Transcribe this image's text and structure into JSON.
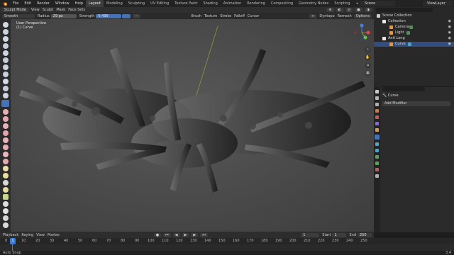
{
  "menubar": {
    "menus": [
      "File",
      "Edit",
      "Render",
      "Window",
      "Help"
    ],
    "workspaces": [
      "Layout",
      "Modeling",
      "Sculpting",
      "UV Editing",
      "Texture Paint",
      "Shading",
      "Animation",
      "Rendering",
      "Compositing",
      "Geometry Nodes",
      "Scripting"
    ],
    "active_workspace": "Layout",
    "scene": "Scene",
    "view_layer": "ViewLayer"
  },
  "header": {
    "mode": "Sculpt Mode",
    "menus": [
      "View",
      "Sculpt",
      "Mask",
      "Face Sets"
    ],
    "brush_name": "Smooth",
    "radius_label": "Radius",
    "radius_value": "29 px",
    "strength_label": "Strength",
    "strength_value": "0.499",
    "dropdowns": [
      "Brush",
      "Texture",
      "Stroke",
      "Falloff",
      "Cursor"
    ],
    "right_controls": [
      "Dyntopo",
      "Remesh",
      "Options"
    ]
  },
  "viewport": {
    "view_name": "User Perspective",
    "object_label": "(1) Curve"
  },
  "outliner": {
    "root": "Scene Collection",
    "items": [
      {
        "label": "Collection",
        "depth": 1
      },
      {
        "label": "Camera",
        "depth": 2
      },
      {
        "label": "Light",
        "depth": 2
      },
      {
        "label": "Anti Long",
        "depth": 1
      },
      {
        "label": "Curve",
        "depth": 2
      }
    ]
  },
  "properties": {
    "object_name": "Curve",
    "add_modifier": "Add Modifier"
  },
  "timeline": {
    "menus": [
      "Playback",
      "Keying",
      "View",
      "Marker"
    ],
    "current_frame": "1",
    "start_label": "Start",
    "start_value": "1",
    "end_label": "End",
    "end_value": "250",
    "ticks": [
      "0",
      "10",
      "20",
      "30",
      "40",
      "50",
      "60",
      "70",
      "80",
      "90",
      "100",
      "110",
      "120",
      "130",
      "140",
      "150",
      "160",
      "170",
      "180",
      "190",
      "200",
      "210",
      "220",
      "230",
      "240",
      "250"
    ],
    "frame_indicator": "1"
  },
  "statusbar": {
    "left": "Auto Snap",
    "right": "3.4"
  },
  "colors": {
    "accent": "#4772b3",
    "selection": "#334d80",
    "playhead": "#3d7bd9"
  }
}
